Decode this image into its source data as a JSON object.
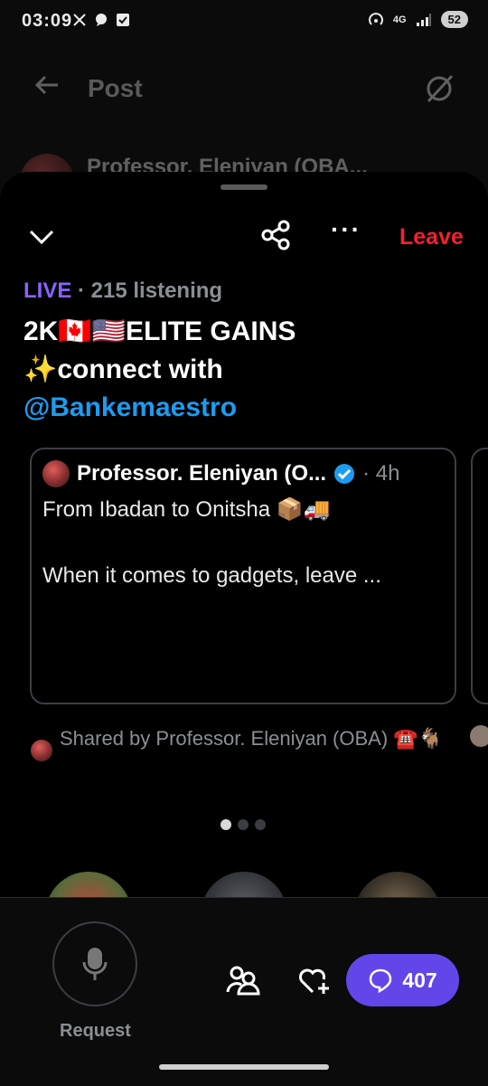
{
  "status_bar": {
    "time": "03:09",
    "network": "4G",
    "battery": "52"
  },
  "page": {
    "title": "Post",
    "author": "Professor. Eleniyan (OBA..."
  },
  "space": {
    "leave_label": "Leave",
    "live_label": "LIVE",
    "listening": "· 215 listening",
    "title_line1": "2K🇨🇦🇺🇸ELITE GAINS",
    "title_line2": "✨connect with",
    "title_mention": "@Bankemaestro"
  },
  "pinned_post": {
    "author": "Professor. Eleniyan (O...",
    "time": "· 4h",
    "line1": "From Ibadan to Onitsha 📦🚚",
    "line2": "When it comes to gadgets, leave ...",
    "shared_by": "Shared by Professor. Eleniyan (OBA) ☎️🐐"
  },
  "bottom_bar": {
    "request_label": "Request",
    "comment_count": "407"
  },
  "colors": {
    "live": "#8a63ff",
    "leave": "#f4212e",
    "mention": "#1d9bf0",
    "comment_button": "#6246ea"
  },
  "icons": [
    "x-logo-icon",
    "chat-icon",
    "check-icon",
    "hotspot-icon",
    "signal-icon",
    "back-arrow-icon",
    "grok-icon",
    "chevron-down-icon",
    "share-icon",
    "more-icon",
    "verified-icon",
    "mic-icon",
    "people-icon",
    "heart-plus-icon",
    "comment-icon"
  ]
}
